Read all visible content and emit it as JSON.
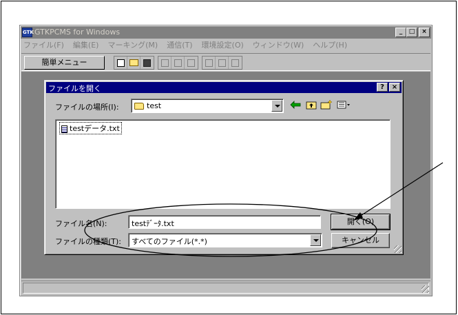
{
  "app": {
    "title": "GTKPCMS for Windows",
    "icon_label": "GTK",
    "window_buttons": {
      "minimize": "_",
      "maximize": "□",
      "close": "×"
    }
  },
  "menubar": {
    "items": [
      "ファイル(F)",
      "編集(E)",
      "マーキング(M)",
      "通信(T)",
      "環境設定(O)",
      "ウィンドウ(W)",
      "ヘルプ(H)"
    ]
  },
  "toolbar": {
    "simple_menu_label": "簡単メニュー",
    "icons": [
      "new-file-icon",
      "open-folder-icon",
      "save-icon",
      "cut-icon",
      "copy-icon",
      "paste-icon",
      "tile-horizontal-icon",
      "tile-vertical-icon",
      "cascade-icon"
    ]
  },
  "dialog": {
    "title": "ファイルを開く",
    "help_btn": "?",
    "close_btn": "×",
    "look_in_label": "ファイルの場所(I):",
    "look_in_value": "test",
    "files": [
      "testデータ.txt"
    ],
    "filename_label": "ファイル名(N):",
    "filename_value": "testﾃﾞｰﾀ.txt",
    "filetype_label": "ファイルの種類(T):",
    "filetype_value": "すべてのファイル(*.*)",
    "open_button": "開く(O)",
    "cancel_button": "キャンセル"
  },
  "colors": {
    "dialog_titlebar": "#000080",
    "app_titlebar_inactive": "#808080",
    "face": "#c0c0c0"
  }
}
